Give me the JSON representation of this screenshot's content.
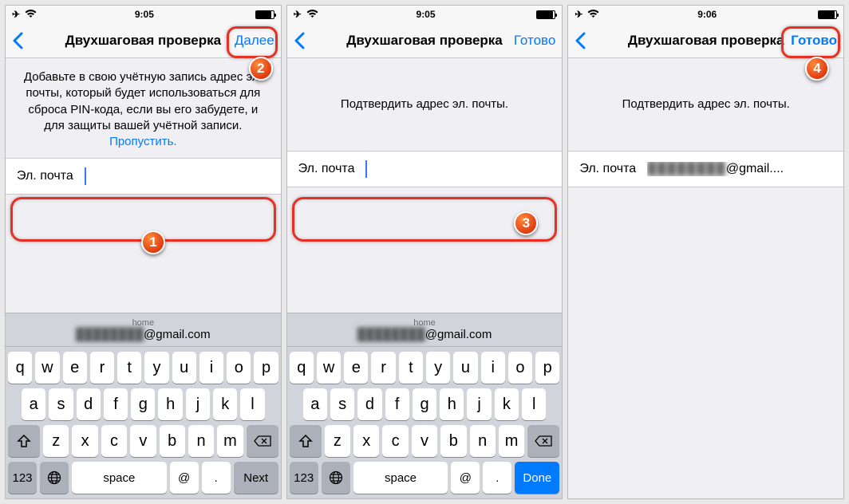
{
  "screens": [
    {
      "status": {
        "time": "9:05"
      },
      "nav": {
        "title": "Двухшаговая проверка",
        "action": "Далее"
      },
      "desc": "Добавьте в свою учётную запись адрес эл. почты, который будет использоваться для сброса PIN-кода, если вы его забудете, и для защиты вашей учётной записи.",
      "skip": "Пропустить.",
      "field": {
        "label": "Эл. почта",
        "value": ""
      },
      "suggest": {
        "label": "home",
        "email_blur": "████████",
        "email_tail": "@gmail.com"
      },
      "action_key": "Next",
      "action_key_style": "next",
      "step_field": "1",
      "step_action": "2"
    },
    {
      "status": {
        "time": "9:05"
      },
      "nav": {
        "title": "Двухшаговая проверка",
        "action": "Готово"
      },
      "desc": "Подтвердить адрес эл. почты.",
      "field": {
        "label": "Эл. почта",
        "value": ""
      },
      "suggest": {
        "label": "home",
        "email_blur": "████████",
        "email_tail": "@gmail.com"
      },
      "action_key": "Done",
      "action_key_style": "done",
      "step_field": "3"
    },
    {
      "status": {
        "time": "9:06"
      },
      "nav": {
        "title": "Двухшаговая проверка",
        "action": "Готово"
      },
      "desc": "Подтвердить адрес эл. почты.",
      "field": {
        "label": "Эл. почта",
        "value_blur": "████████",
        "value_tail": "@gmail...."
      },
      "step_action": "4"
    }
  ],
  "kbd": {
    "row1": [
      "q",
      "w",
      "e",
      "r",
      "t",
      "y",
      "u",
      "i",
      "o",
      "p"
    ],
    "row2": [
      "a",
      "s",
      "d",
      "f",
      "g",
      "h",
      "j",
      "k",
      "l"
    ],
    "row3": [
      "z",
      "x",
      "c",
      "v",
      "b",
      "n",
      "m"
    ],
    "n123": "123",
    "space": "space",
    "at": "@",
    "dot": "."
  }
}
